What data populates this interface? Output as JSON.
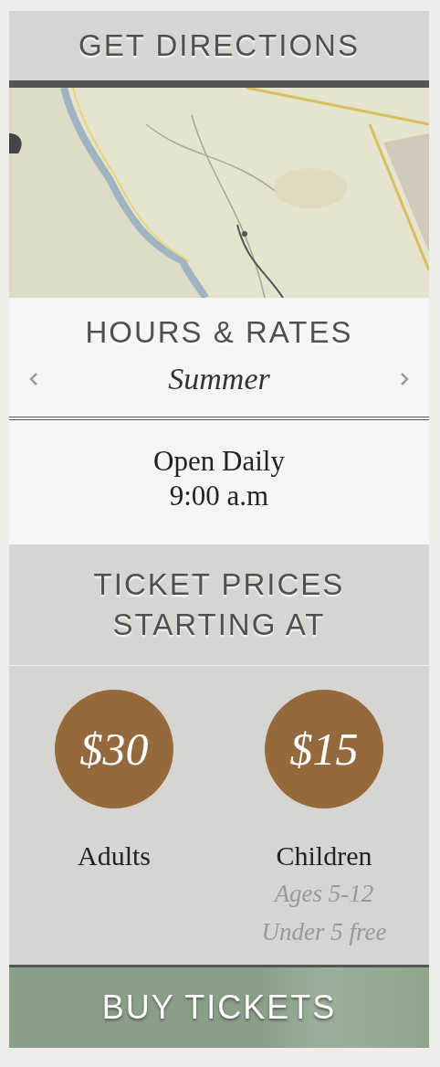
{
  "directions_button": {
    "label": "GET DIRECTIONS"
  },
  "hours": {
    "title": "HOURS & RATES",
    "season": "Summer",
    "schedule": [
      "Open Daily",
      "9:00 a.m"
    ]
  },
  "tickets": {
    "title": [
      "TICKET PRICES",
      "STARTING AT"
    ],
    "prices": [
      {
        "amount": "$30",
        "label": "Adults"
      },
      {
        "amount": "$15",
        "label": "Children",
        "notes": [
          "Ages 5-12",
          "Under 5 free"
        ]
      }
    ]
  },
  "buy_button": {
    "label": "BUY TICKETS"
  }
}
